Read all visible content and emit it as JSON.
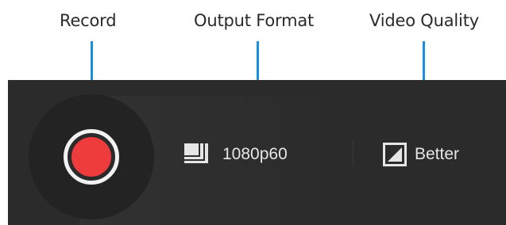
{
  "annotations": {
    "record_label": "Record",
    "output_format_label": "Output Format",
    "video_quality_label": "Video Quality",
    "accent_color": "#1a8fe0"
  },
  "toolbar": {
    "background_color": "#2b2b2b",
    "record_button": {
      "icon": "record-icon",
      "color": "#ee3b3b"
    },
    "output_format": {
      "icon": "stacked-frames-icon",
      "value": "1080p60"
    },
    "video_quality": {
      "icon": "quality-contrast-icon",
      "value": "Better"
    }
  }
}
